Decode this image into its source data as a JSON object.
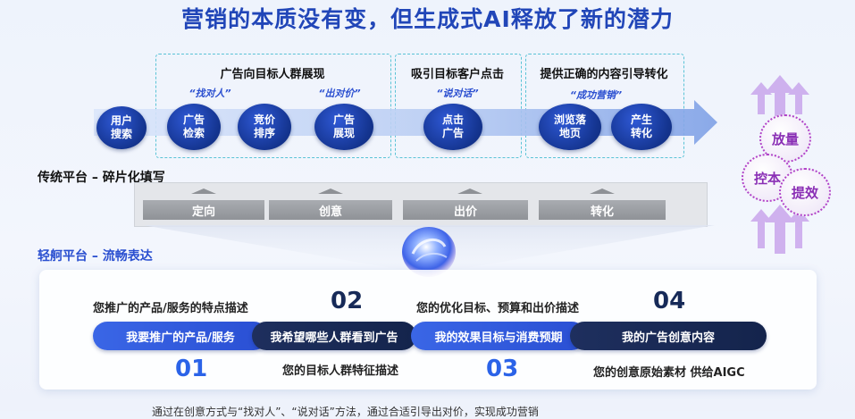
{
  "title": "营销的本质没有变，但生成式AI释放了新的潜力",
  "groups": [
    {
      "label": "广告向目标人群展现"
    },
    {
      "label": "吸引目标客户点击"
    },
    {
      "label": "提供正确的内容引导转化"
    }
  ],
  "quotes": [
    "“找对人”",
    "“出对价”",
    "“说对话”",
    "“成功营销”"
  ],
  "funnel_steps": [
    {
      "line1": "用户",
      "line2": "搜索"
    },
    {
      "line1": "广告",
      "line2": "检索"
    },
    {
      "line1": "竞价",
      "line2": "排序"
    },
    {
      "line1": "广告",
      "line2": "展现"
    },
    {
      "line1": "点击",
      "line2": "广告"
    },
    {
      "line1": "浏览落",
      "line2": "地页"
    },
    {
      "line1": "产生",
      "line2": "转化"
    }
  ],
  "traditional": {
    "label": "传统平台 – 碎片化填写",
    "segments": [
      "定向",
      "创意",
      "出价",
      "转化"
    ]
  },
  "qingzhou": {
    "label": "轻舸平台 – 流畅表达",
    "pills": [
      "我要推广的产品/服务",
      "我希望哪些人群看到广告",
      "我的效果目标与消费预期",
      "我的广告创意内容"
    ],
    "numbers": [
      "01",
      "02",
      "03",
      "04"
    ],
    "descriptions": [
      "您推广的产品/服务的特点描述",
      "您的目标人群特征描述",
      "您的优化目标、预算和出价描述",
      "您的创意原始素材 供给AIGC"
    ]
  },
  "bubbles": [
    "放量",
    "控本",
    "提效"
  ],
  "colors": {
    "primary": "#2146b8",
    "accent_blue": "#2b63e8",
    "dark_navy": "#14244c",
    "bubble_purple": "#8a2fb5"
  },
  "footnote": "通过在创意方式与“找对人”、“说对话”方法，通过合适引导出对价，实现成功营销"
}
